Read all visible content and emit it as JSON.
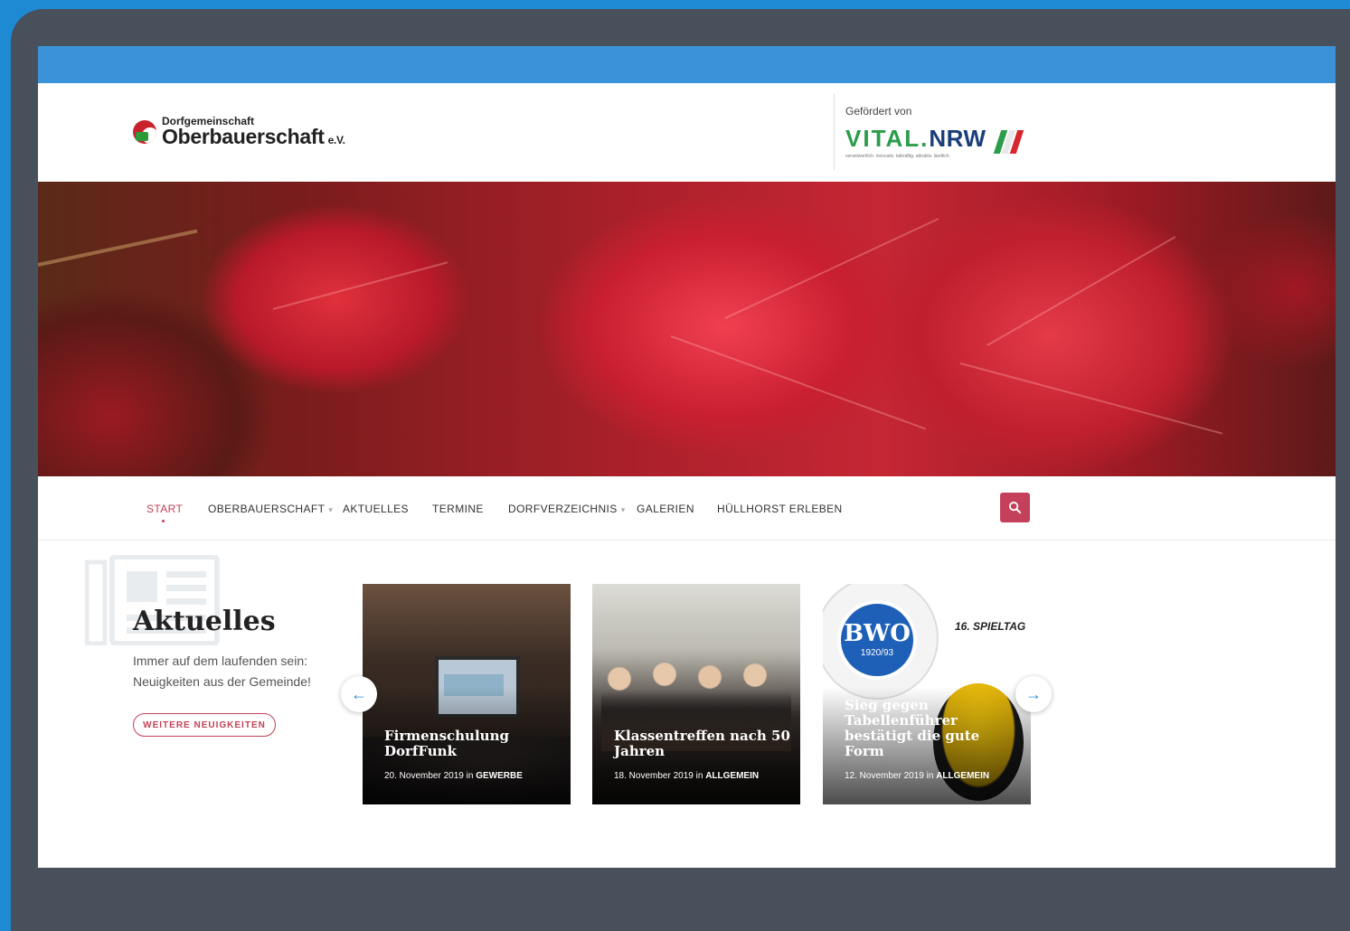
{
  "header": {
    "logo_small": "Dorfgemeinschaft",
    "logo_big": "Oberbauerschaft",
    "logo_suffix": "e.V.",
    "sponsor_label": "Gefördert von",
    "sponsor_name_a": "VITAL.",
    "sponsor_name_b": "NRW",
    "sponsor_tagline": "verantwortlich. innovativ. tatkräftig. attraktiv. ländlich."
  },
  "nav": {
    "items": [
      {
        "label": "START",
        "active": true
      },
      {
        "label": "OBERBAUERSCHAFT",
        "dropdown": true
      },
      {
        "label": "AKTUELLES"
      },
      {
        "label": "TERMINE"
      },
      {
        "label": "DORFVERZEICHNIS",
        "dropdown": true
      },
      {
        "label": "GALERIEN"
      },
      {
        "label": "HÜLLHORST ERLEBEN"
      }
    ],
    "search_icon": "search-icon"
  },
  "news": {
    "title": "Aktuelles",
    "subtitle_line1": "Immer auf dem laufenden sein:",
    "subtitle_line2": "Neuigkeiten aus der Gemeinde!",
    "more_button": "WEITERE NEUIGKEITEN",
    "prev_arrow": "←",
    "next_arrow": "→",
    "cards": [
      {
        "title": "Firmenschulung DorfFunk",
        "date": "20. November 2019",
        "in": "in",
        "category": "GEWERBE"
      },
      {
        "title": "Klassentreffen nach 50 Jahren",
        "date": "18. November 2019",
        "in": "in",
        "category": "ALLGEMEIN"
      },
      {
        "title": "Sieg gegen Tabellenführer bestätigt die gute Form",
        "date": "12. November 2019",
        "in": "in",
        "category": "ALLGEMEIN",
        "badge_text": "16. SPIELTAG",
        "club_initials": "BWO",
        "club_year": "1920/93"
      }
    ]
  },
  "colors": {
    "accent": "#c44055",
    "topbar": "#3a92d8",
    "frame": "#48505b",
    "background": "#1e8ad3"
  }
}
